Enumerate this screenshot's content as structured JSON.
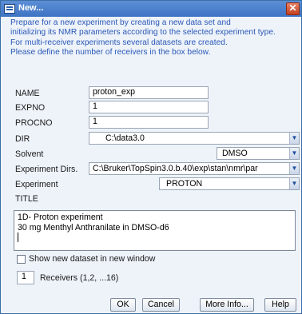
{
  "window": {
    "title": "New...",
    "close_glyph": "✕",
    "app_icon": "dialog-icon"
  },
  "info_lines": [
    "Prepare for a new experiment by creating a new data set and",
    "initializing its NMR parameters according to the selected experiment type.",
    "For multi-receiver experiments several datasets are created.",
    "Please define the number of receivers in the box below."
  ],
  "fields": {
    "name": {
      "label": "NAME",
      "value": "proton_exp"
    },
    "expno": {
      "label": "EXPNO",
      "value": "1"
    },
    "procno": {
      "label": "PROCNO",
      "value": "1"
    },
    "dir": {
      "label": "DIR",
      "value": "C:\\data3.0"
    },
    "solvent": {
      "label": "Solvent",
      "value": "DMSO"
    },
    "experiment_dirs": {
      "label": "Experiment Dirs.",
      "value": "C:\\Bruker\\TopSpin3.0.b.40\\exp\\stan\\nmr\\par"
    },
    "experiment": {
      "label": "Experiment",
      "value": "PROTON"
    }
  },
  "title": {
    "label": "TITLE",
    "lines": [
      "1D- Proton experiment",
      "30 mg Menthyl Anthranilate in DMSO-d6"
    ]
  },
  "show_new_dataset": {
    "label": "Show new dataset in new window",
    "checked": false
  },
  "receivers": {
    "value": "1",
    "label": "Receivers (1,2, ...16)"
  },
  "buttons": {
    "ok": "OK",
    "cancel": "Cancel",
    "more_info": "More Info...",
    "help": "Help"
  },
  "colors": {
    "title_bar": "#4a7fcf",
    "info_text": "#2a58b6",
    "close_button": "#d4532f",
    "background": "#eef3fa"
  }
}
